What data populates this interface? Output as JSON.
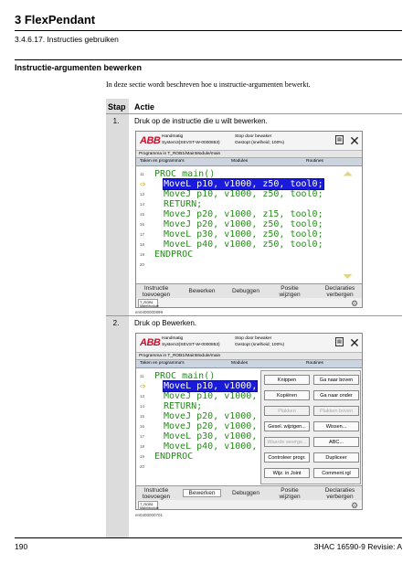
{
  "header": {
    "chapter": "3 FlexPendant",
    "subsection": "3.4.6.17. Instructies gebruiken"
  },
  "section": {
    "heading": "Instructie-argumenten bewerken",
    "intro": "In deze sectie wordt beschreven hoe u instructie-argumenten bewerkt."
  },
  "table": {
    "col_step": "Stap",
    "col_action": "Actie",
    "steps": [
      {
        "num": "1.",
        "text": "Druk op de instructie die u wilt bewerken."
      },
      {
        "num": "2.",
        "text": "Druk op Bewerken."
      }
    ]
  },
  "pendant": {
    "logo": "ABB",
    "mode": "Handmatig",
    "system": "System3(SEVST-W-0000853)",
    "status": "Stop door bewaker",
    "speed": "Gestopt (snelheid; 100%)",
    "program_bar": "Programma in T_ROB1/MainModule/main",
    "menu": [
      "Taken en programma's",
      "Modules",
      "Routines"
    ],
    "line_numbers": [
      "11",
      "12",
      "13",
      "14",
      "15",
      "16",
      "17",
      "18",
      "19",
      "20"
    ],
    "code_lines": [
      "PROC main()",
      "MoveL p10, v1000, z50, tool0;",
      "MoveJ p10, v1000, z50, tool0;",
      "RETURN;",
      "MoveJ p20, v1000, z15, tool0;",
      "MoveJ p20, v1000, z50, tool0;",
      "MoveL p30, v1000, z50, tool0;",
      "MoveL p40, v1000, z50, tool0;",
      "ENDPROC"
    ],
    "code_lines_short": [
      "PROC main()",
      "MoveL p10, v1000,",
      "MoveJ p10, v1000,",
      "RETURN;",
      "MoveJ p20, v1000,",
      "MoveJ p20, v1000,",
      "MoveL p30, v1000,",
      "MoveL p40, v1000,",
      "ENDPROC"
    ],
    "bottom_buttons": [
      "Instructie toevoegen",
      "Bewerken",
      "Debuggen",
      "Positie wijzigen",
      "Declaraties verbergen"
    ],
    "task_tab": "T_ROB1 MainModule",
    "figure_ids": [
      "en0400000899",
      "en0400000701"
    ],
    "popup": {
      "left": [
        "Knippen",
        "Kopiëren",
        "Plakken",
        "Gesel. wijzigen...",
        "Waarde weerge...",
        "Controleer progr.",
        "Wijz. in Joint"
      ],
      "right": [
        "Ga naar boven",
        "Ga naar onder",
        "Plakken boven",
        "Wissen...",
        "ABC...",
        "Dupliceer",
        "Comment.rgl"
      ]
    }
  },
  "footer": {
    "page": "190",
    "doc": "3HAC 16590-9 Revisie: A"
  }
}
